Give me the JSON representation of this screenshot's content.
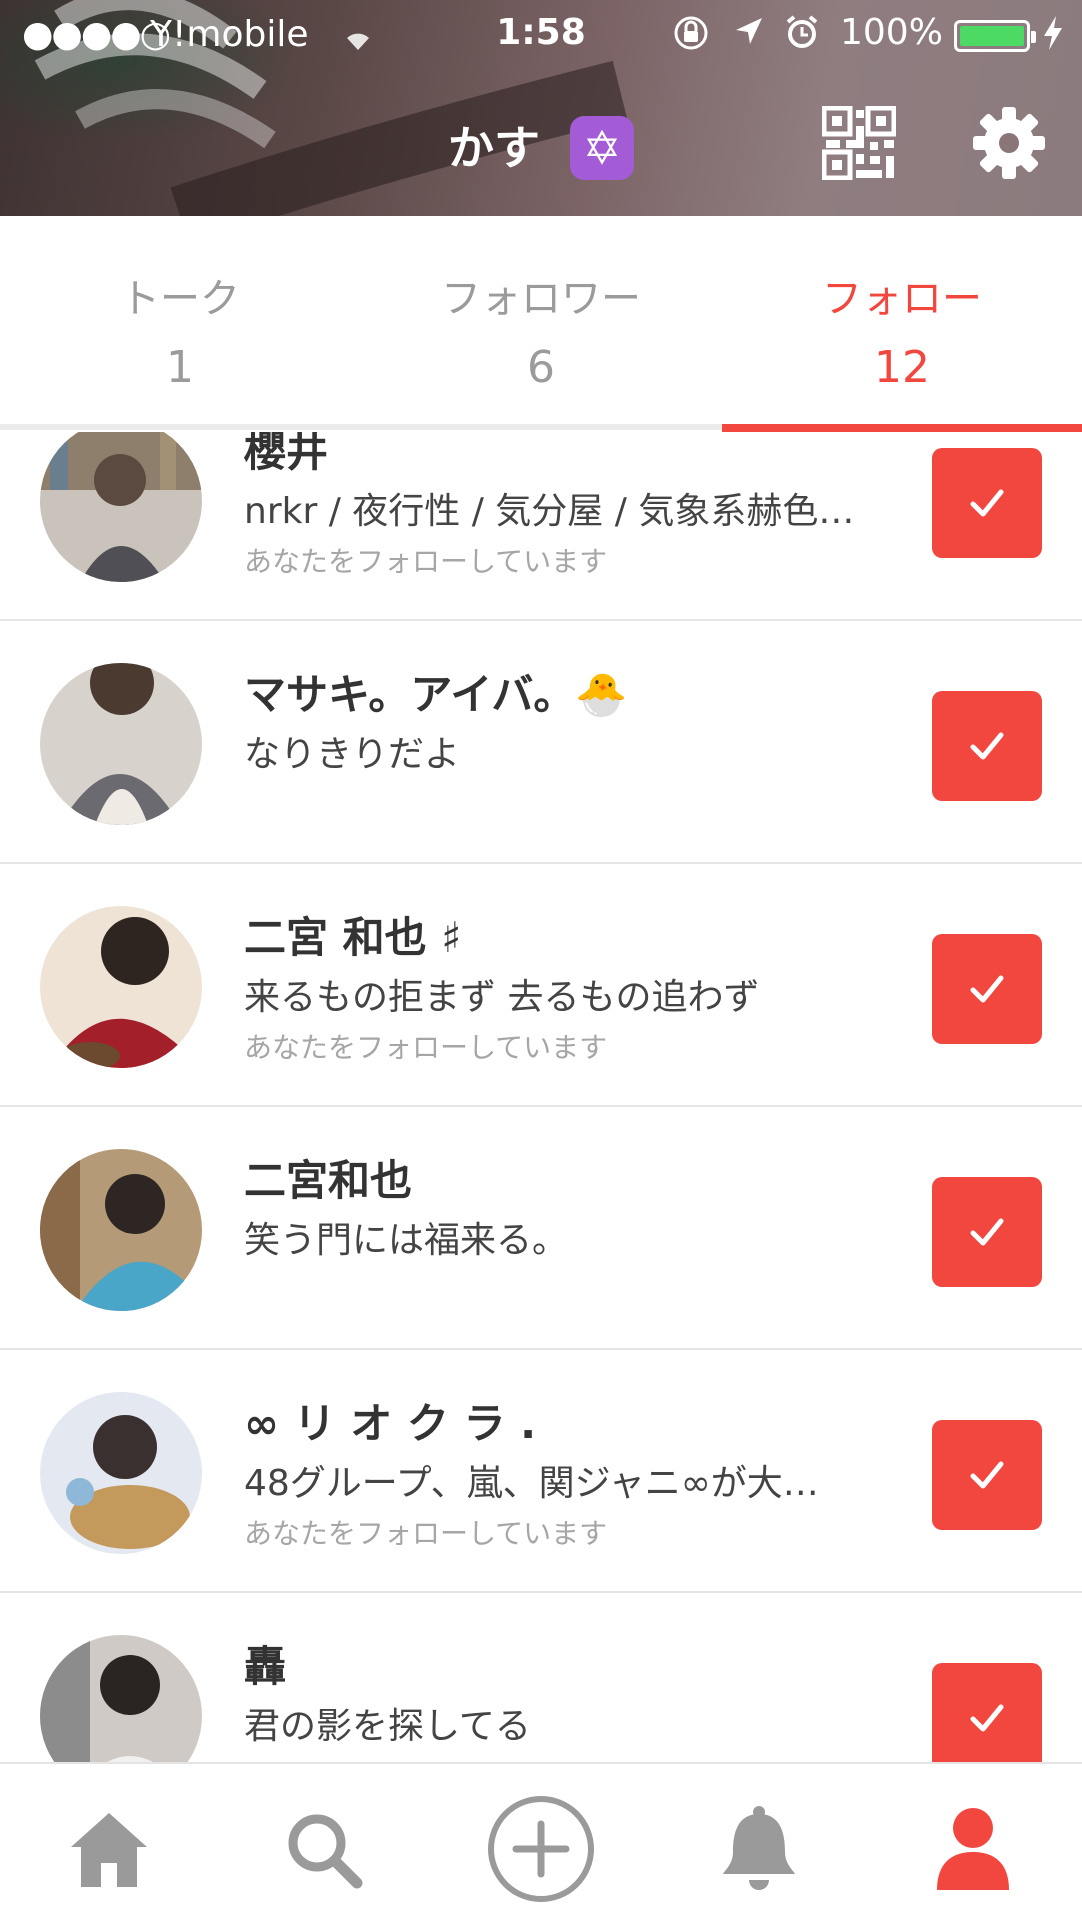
{
  "status_bar": {
    "signal": "●●●●○",
    "carrier": "Y!mobile",
    "time": "1:58",
    "battery_percent": "100%"
  },
  "header": {
    "profile_name": "かす",
    "badge_glyph": "✡",
    "badge_color": "#a35bd6",
    "icons": [
      "qr-code-icon",
      "gear-icon"
    ]
  },
  "tabs": [
    {
      "label": "トーク",
      "count": "1",
      "active": false
    },
    {
      "label": "フォロワー",
      "count": "6",
      "active": false
    },
    {
      "label": "フォロー",
      "count": "12",
      "active": true
    }
  ],
  "accent_color": "#f2473f",
  "follows": [
    {
      "name": "櫻井",
      "bio": "nrkr / 夜行性 / 気分屋 / 気象系赫色…",
      "note": "あなたをフォローしています",
      "following": true
    },
    {
      "name": "マサキ。アイバ。🐣",
      "bio": "なりきりだよ",
      "note": "",
      "following": true
    },
    {
      "name": "二宮 和也 ♯",
      "bio": "来るもの拒まず 去るもの追わず",
      "note": "あなたをフォローしています",
      "following": true
    },
    {
      "name": "二宮和也",
      "bio": "笑う門には福来る。",
      "note": "",
      "following": true
    },
    {
      "name": "∞ リ オ ク ラ .",
      "bio": "48グループ、嵐、関ジャニ∞が大…",
      "note": "あなたをフォローしています",
      "following": true
    },
    {
      "name": "轟",
      "bio": "君の影を探してる",
      "note": "",
      "following": true
    }
  ],
  "bottom_nav": [
    "home-icon",
    "search-icon",
    "add-post-icon",
    "notifications-bell-icon",
    "profile-icon"
  ]
}
